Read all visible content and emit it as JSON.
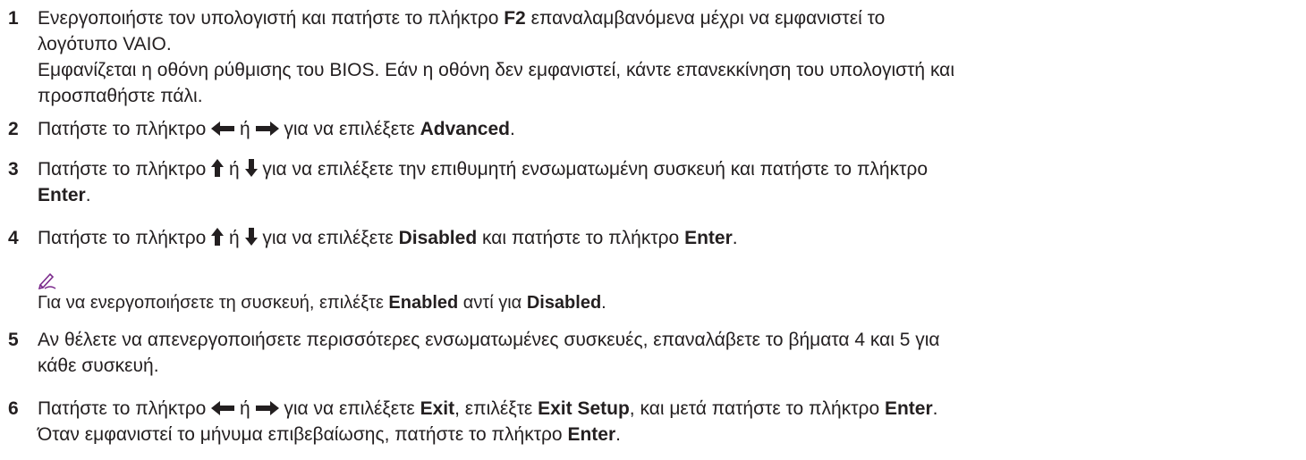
{
  "steps": [
    {
      "number": "1",
      "line1_pre": "Ενεργοποιήστε τον υπολογιστή και πατήστε το πλήκτρο ",
      "line1_key": "F2",
      "line1_post": " επαναλαμβανόμενα μέχρι να εμφανιστεί το",
      "line2": "λογότυπο VAIO.",
      "line3": "Εμφανίζεται η οθόνη ρύθμισης του BIOS. Εάν η οθόνη δεν εμφανιστεί, κάντε επανεκκίνηση του υπολογιστή και",
      "line4": "προσπαθήστε πάλι."
    },
    {
      "number": "2",
      "pre": "Πατήστε το πλήκτρο ",
      "or": " ή ",
      "mid": " για να επιλέξετε ",
      "bold": "Advanced",
      "end": "."
    },
    {
      "number": "3",
      "pre": "Πατήστε το πλήκτρο ",
      "or": " ή ",
      "mid": " για να επιλέξετε την επιθυμητή ενσωματωμένη συσκευή και πατήστε το πλήκτρο",
      "bold": "Enter",
      "end": "."
    },
    {
      "number": "4",
      "pre": "Πατήστε το πλήκτρο ",
      "or": " ή ",
      "mid": " για να επιλέξετε ",
      "bold1": "Disabled",
      "mid2": " και πατήστε το πλήκτρο ",
      "bold2": "Enter",
      "end": "."
    },
    {
      "number": "5",
      "line1": "Αν θέλετε να απενεργοποιήσετε περισσότερες ενσωματωμένες συσκευές, επαναλάβετε το βήματα 4 και 5 για",
      "line2": "κάθε συσκευή."
    },
    {
      "number": "6",
      "pre": "Πατήστε το πλήκτρο ",
      "or": " ή ",
      "mid": " για να επιλέξετε ",
      "bold1": "Exit",
      "mid2": ", επιλέξτε ",
      "bold2": "Exit Setup",
      "mid3": ", και μετά πατήστε το πλήκτρο ",
      "bold3": "Enter",
      "end": ".",
      "line2_pre": "Όταν εμφανιστεί το μήνυμα επιβεβαίωσης, πατήστε το πλήκτρο ",
      "line2_bold": "Enter",
      "line2_end": "."
    }
  ],
  "note": {
    "icon": "pen-note-icon",
    "pre": "Για να ενεργοποιήσετε τη συσκευή, επιλέξτε ",
    "bold1": "Enabled",
    "mid": " αντί για ",
    "bold2": "Disabled",
    "end": ".",
    "color": "#7b2a8c"
  }
}
